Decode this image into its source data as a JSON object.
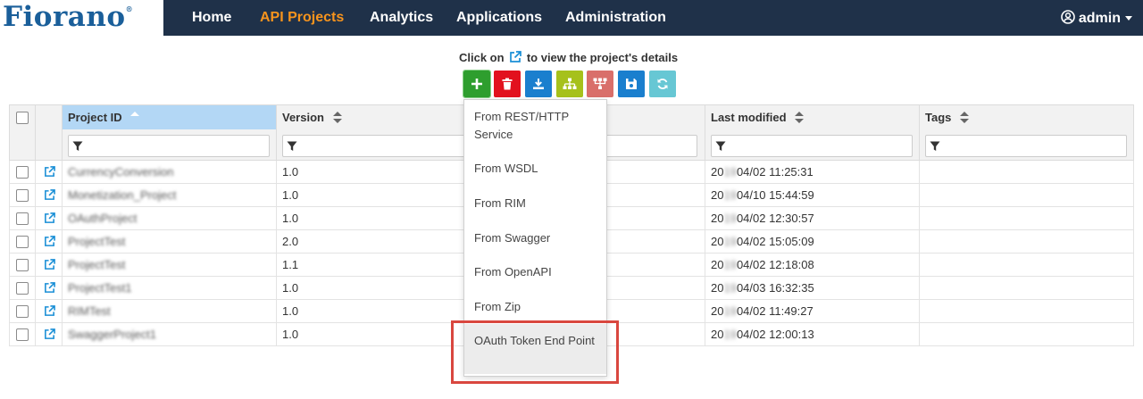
{
  "brand": {
    "logo": "Fiorano",
    "reg": "®"
  },
  "nav": {
    "items": [
      {
        "label": "Home",
        "active": false
      },
      {
        "label": "API Projects",
        "active": true
      },
      {
        "label": "Analytics",
        "active": false
      },
      {
        "label": "Applications",
        "active": false
      },
      {
        "label": "Administration",
        "active": false
      }
    ]
  },
  "user": {
    "name": "admin"
  },
  "hint": {
    "before": "Click on",
    "after": "to view the project's details"
  },
  "toolbar": {
    "buttons": [
      {
        "name": "add",
        "color": "#2e9e2e",
        "icon": "plus-icon"
      },
      {
        "name": "delete",
        "color": "#e2111e",
        "icon": "trash-icon"
      },
      {
        "name": "download",
        "color": "#1a7fce",
        "icon": "download-icon"
      },
      {
        "name": "hierarchy",
        "color": "#a6c11b",
        "icon": "sitemap-icon"
      },
      {
        "name": "network",
        "color": "#d96f6a",
        "icon": "network-icon"
      },
      {
        "name": "save",
        "color": "#1a7fce",
        "icon": "save-icon"
      },
      {
        "name": "refresh",
        "color": "#67c7d4",
        "icon": "refresh-icon"
      }
    ]
  },
  "table": {
    "headers": {
      "project_id": "Project ID",
      "version": "Version",
      "last_modified": "Last modified",
      "tags": "Tags"
    },
    "rows": [
      {
        "project_id": "CurrencyConversion",
        "version": "1.0",
        "mod_prefix": "20",
        "mod_hidden": "19",
        "mod_rest": "04/02 11:25:31",
        "tags": ""
      },
      {
        "project_id": "Monetization_Project",
        "version": "1.0",
        "mod_prefix": "20",
        "mod_hidden": "19",
        "mod_rest": "04/10 15:44:59",
        "tags": ""
      },
      {
        "project_id": "OAuthProject",
        "version": "1.0",
        "mod_prefix": "20",
        "mod_hidden": "19",
        "mod_rest": "04/02 12:30:57",
        "tags": ""
      },
      {
        "project_id": "ProjectTest",
        "version": "2.0",
        "mod_prefix": "20",
        "mod_hidden": "19",
        "mod_rest": "04/02 15:05:09",
        "tags": ""
      },
      {
        "project_id": "ProjectTest",
        "version": "1.1",
        "mod_prefix": "20",
        "mod_hidden": "19",
        "mod_rest": "04/02 12:18:08",
        "tags": ""
      },
      {
        "project_id": "ProjectTest1",
        "version": "1.0",
        "mod_prefix": "20",
        "mod_hidden": "19",
        "mod_rest": "04/03 16:32:35",
        "tags": ""
      },
      {
        "project_id": "RIMTest",
        "version": "1.0",
        "mod_prefix": "20",
        "mod_hidden": "19",
        "mod_rest": "04/02 11:49:27",
        "tags": ""
      },
      {
        "project_id": "SwaggerProject1",
        "version": "1.0",
        "mod_prefix": "20",
        "mod_hidden": "19",
        "mod_rest": "04/02 12:00:13",
        "tags": ""
      }
    ]
  },
  "dropdown": {
    "items": [
      "From REST/HTTP Service",
      "From WSDL",
      "From RIM",
      "From Swagger",
      "From OpenAPI",
      "From Zip",
      "OAuth Token End Point"
    ]
  },
  "colors": {
    "topbar": "#1f3149",
    "active_nav": "#f7941d",
    "link_icon": "#1a8fd6",
    "sorted_header": "#b3d7f5",
    "callout": "#d9473f"
  }
}
